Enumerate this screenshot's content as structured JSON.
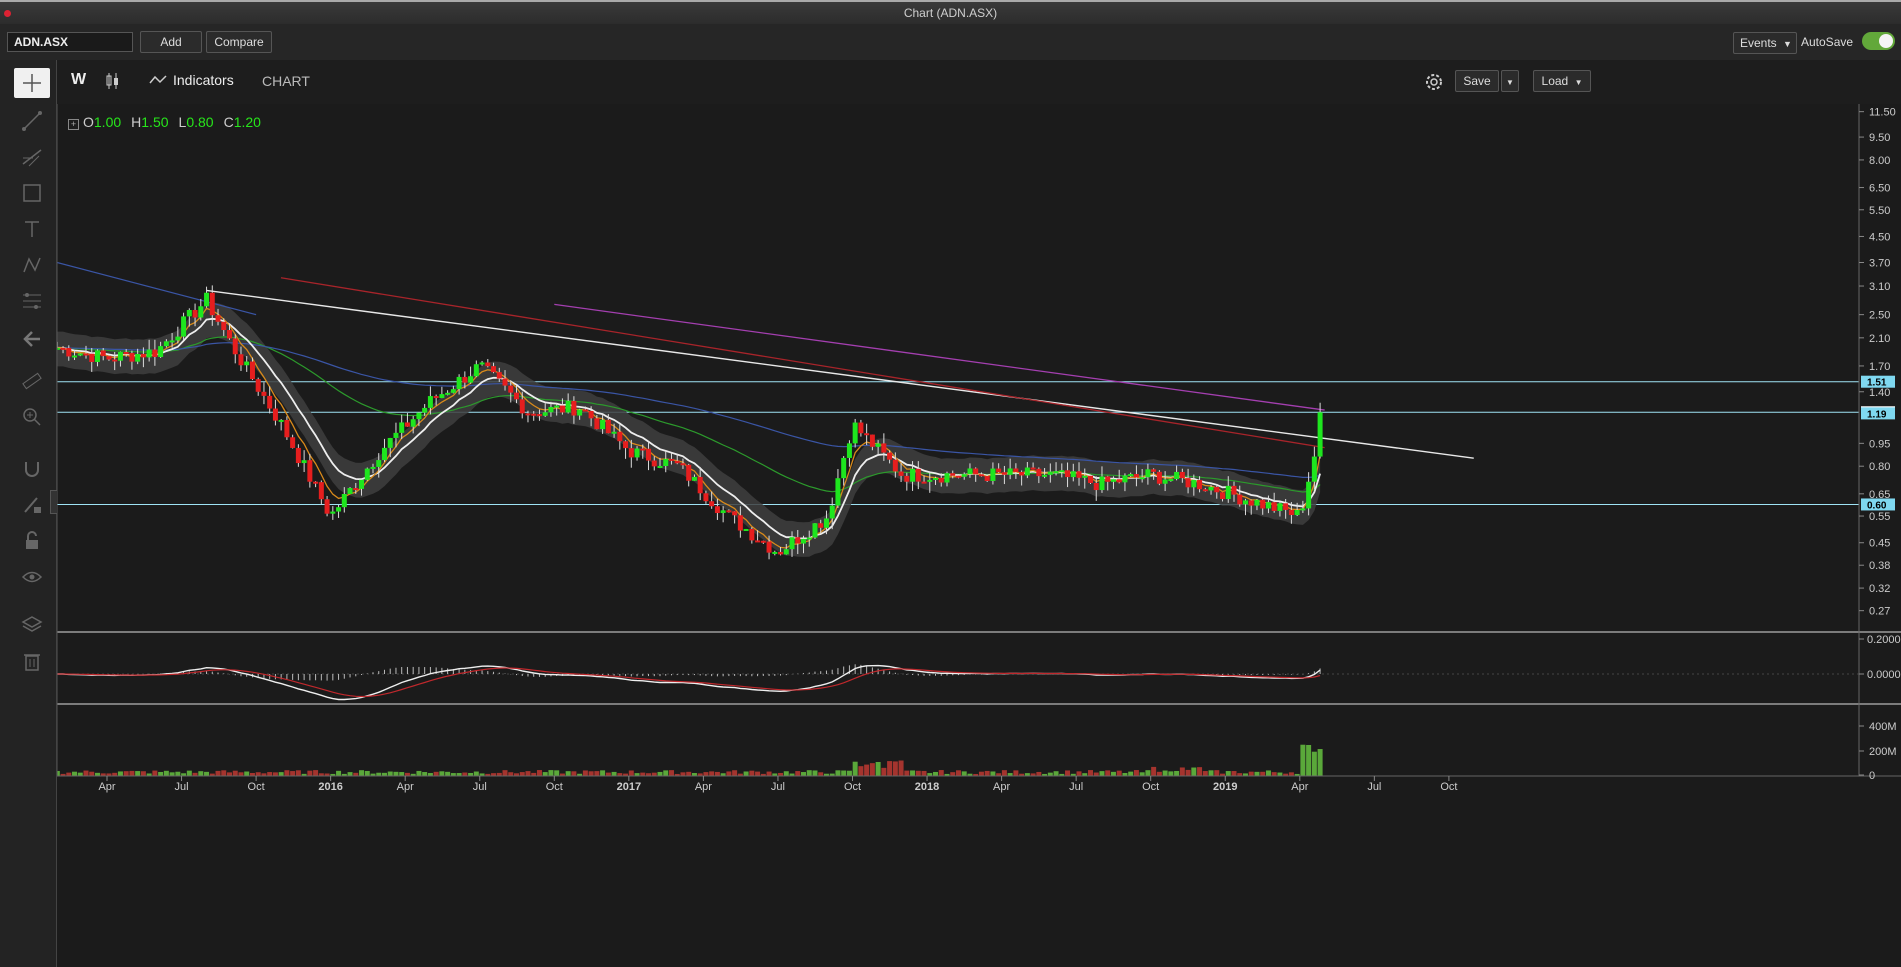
{
  "window": {
    "title": "Chart (ADN.ASX)"
  },
  "toolbar": {
    "symbol": "ADN.ASX",
    "add_label": "Add",
    "compare_label": "Compare",
    "events_label": "Events",
    "autosave_label": "AutoSave",
    "autosave_on": true
  },
  "chart_header": {
    "interval": "W",
    "indicators_label": "Indicators",
    "chart_label": "CHART",
    "save_label": "Save",
    "load_label": "Load"
  },
  "ohlc": {
    "o_label": "O",
    "o": "1.00",
    "h_label": "H",
    "h": "1.50",
    "l_label": "L",
    "l": "0.80",
    "c_label": "C",
    "c": "1.20"
  },
  "sidebar_tools": [
    "crosshair-icon",
    "trendline-icon",
    "fib-icon",
    "rectangle-icon",
    "text-icon",
    "pattern-icon",
    "gann-icon",
    "back-arrow-icon",
    "ruler-icon",
    "zoom-icon",
    "magnet-icon",
    "lock-pencil-icon",
    "lock-icon",
    "eye-icon",
    "layers-icon",
    "trash-icon"
  ],
  "chart_data": {
    "type": "line",
    "title": "ADN.ASX",
    "price_axis": {
      "scale": "log",
      "ticks": [
        "11.50",
        "9.50",
        "8.00",
        "6.50",
        "5.50",
        "4.50",
        "3.70",
        "3.10",
        "2.50",
        "2.10",
        "1.70",
        "1.40",
        "0.95",
        "0.80",
        "0.65",
        "0.55",
        "0.45",
        "0.38",
        "0.32",
        "0.27"
      ],
      "ylim": [
        0.23,
        12
      ]
    },
    "price_badges": [
      {
        "value": "1.51",
        "color": "#7fd8f0"
      },
      {
        "value": "1.20",
        "color": "#ffffff"
      },
      {
        "value": "1.19",
        "color": "#7fd8f0"
      },
      {
        "value": "0.60",
        "color": "#7fd8f0"
      }
    ],
    "horizontal_lines": [
      1.51,
      1.2,
      0.6
    ],
    "x_ticks": [
      "Apr",
      "Jul",
      "Oct",
      "2016",
      "Apr",
      "Jul",
      "Oct",
      "2017",
      "Apr",
      "Jul",
      "Oct",
      "2018",
      "Apr",
      "Jul",
      "Oct",
      "2019",
      "Apr",
      "Jul",
      "Oct"
    ],
    "x_dates": [
      "2015-04",
      "2015-07",
      "2015-10",
      "2016-01",
      "2016-04",
      "2016-07",
      "2016-10",
      "2017-01",
      "2017-04",
      "2017-07",
      "2017-10",
      "2018-01",
      "2018-04",
      "2018-07",
      "2018-10",
      "2019-01",
      "2019-04",
      "2019-07",
      "2019-10"
    ],
    "close_series": {
      "name": "",
      "dates": [
        "2015-02",
        "2015-04",
        "2015-06",
        "2015-08",
        "2015-09",
        "2015-11",
        "2016-01",
        "2016-03",
        "2016-05",
        "2016-07",
        "2016-09",
        "2016-11",
        "2017-01",
        "2017-03",
        "2017-05",
        "2017-07",
        "2017-09",
        "2017-10",
        "2017-12",
        "2018-02",
        "2018-04",
        "2018-06",
        "2018-08",
        "2018-10",
        "2018-12",
        "2019-02",
        "2019-04",
        "2019-05"
      ],
      "values": [
        1.95,
        1.8,
        1.9,
        2.8,
        2.0,
        1.1,
        0.55,
        0.9,
        1.3,
        1.7,
        1.2,
        1.25,
        0.9,
        0.8,
        0.55,
        0.42,
        0.55,
        1.1,
        0.75,
        0.75,
        0.75,
        0.75,
        0.7,
        0.75,
        0.7,
        0.62,
        0.55,
        1.2
      ]
    },
    "macd_axis": {
      "ticks": [
        "0.2000",
        "0.0000"
      ]
    },
    "volume_axis": {
      "ticks": [
        "400M",
        "200M",
        "0"
      ]
    }
  }
}
